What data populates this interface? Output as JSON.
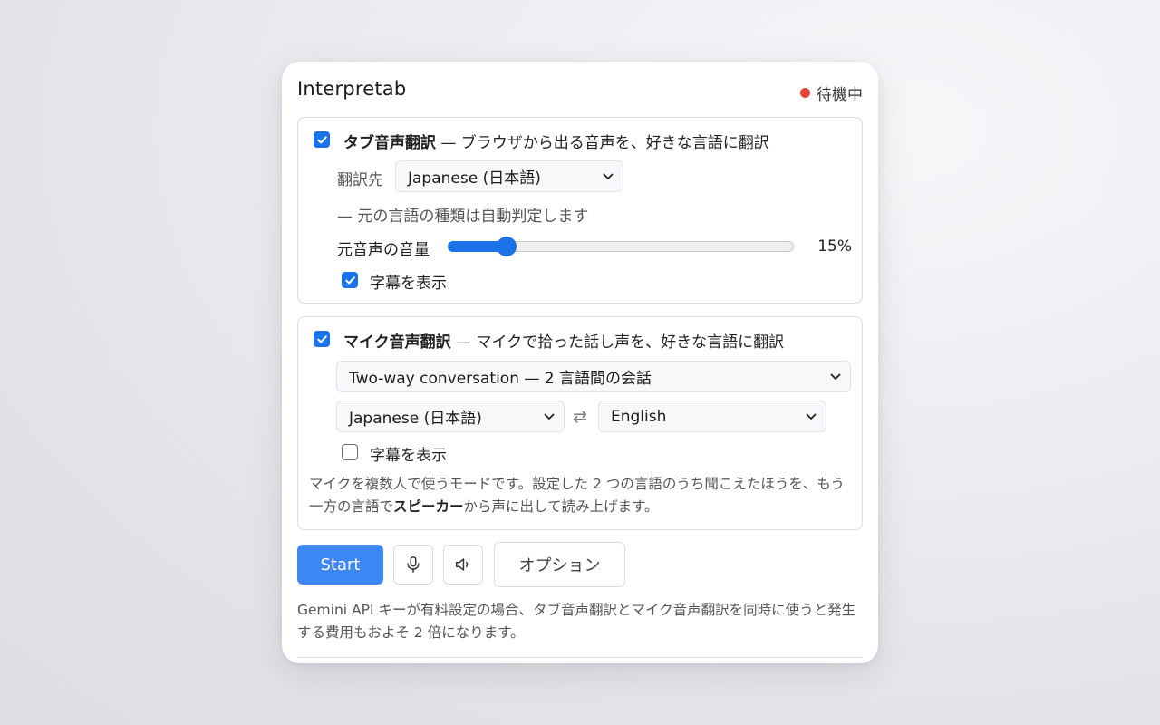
{
  "app": {
    "title": "Interpretab"
  },
  "status": {
    "label": "待機中",
    "dot_color": "#e4453a"
  },
  "tab_section": {
    "enabled": true,
    "title": "タブ音声翻訳",
    "description": " — ブラウザから出る音声を、好きな言語に翻訳",
    "target_label": "翻訳先",
    "target_value": "Japanese (日本語)",
    "auto_detect_note": "— 元の言語の種類は自動判定します",
    "volume_label": "元音声の音量",
    "volume_value": 0.15,
    "volume_text": "15%",
    "subtitles_label": "字幕を表示",
    "subtitles_enabled": true
  },
  "mic_section": {
    "enabled": true,
    "title": "マイク音声翻訳",
    "description": " — マイクで拾った話し声を、好きな言語に翻訳",
    "mode_value": "Two-way conversation — 2 言語間の会話",
    "language_a": "Japanese (日本語)",
    "swap_symbol": "⇄",
    "language_b": "English",
    "subtitles_label": "字幕を表示",
    "subtitles_enabled": false,
    "note_part1": "マイクを複数人で使うモードです。設定した 2 つの言語のうち聞こえたほうを、もう一方の言語で",
    "note_bold": "スピーカー",
    "note_part2": "から声に出して読み上げます。"
  },
  "actions": {
    "start_label": "Start",
    "mic_icon": "microphone-icon",
    "speaker_icon": "speaker-icon",
    "options_label": "オプション",
    "accent": "#3d87f5"
  },
  "footer": {
    "note": "Gemini API キーが有料設定の場合、タブ音声翻訳とマイク音声翻訳を同時に使うと発生する費用もおよそ 2 倍になります。"
  }
}
